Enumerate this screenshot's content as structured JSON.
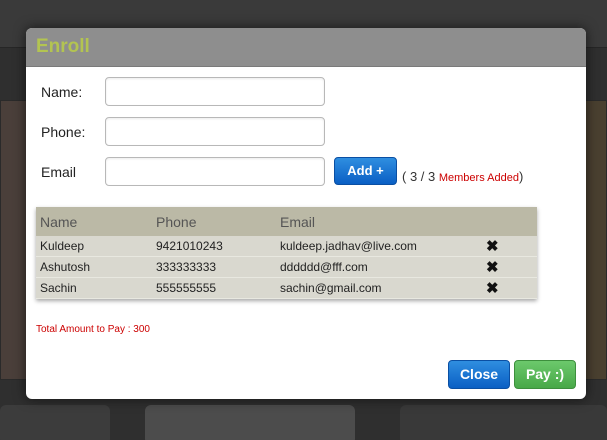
{
  "modal": {
    "title": "Enroll"
  },
  "form": {
    "name_label": "Name:",
    "phone_label": "Phone:",
    "email_label": "Email",
    "name_value": "",
    "phone_value": "",
    "email_value": "",
    "add_button_label": "Add +",
    "counter_prefix": "( 3 / 3 ",
    "counter_members": "Members Added",
    "counter_suffix": ")"
  },
  "members_table": {
    "columns": [
      "Name",
      "Phone",
      "Email"
    ],
    "rows": [
      {
        "name": "Kuldeep",
        "phone": "9421010243",
        "email": "kuldeep.jadhav@live.com"
      },
      {
        "name": "Ashutosh",
        "phone": "333333333",
        "email": "dddddd@fff.com"
      },
      {
        "name": "Sachin",
        "phone": "555555555",
        "email": "sachin@gmail.com"
      }
    ],
    "delete_icon": "✖"
  },
  "total_text": "Total Amount to Pay : 300",
  "footer": {
    "close_label": "Close",
    "pay_label": "Pay :)"
  },
  "colors": {
    "title": "#b3c451",
    "primary_button": "#0a5fc4",
    "pay_button": "#48a848",
    "alert_text": "#cc0000"
  }
}
